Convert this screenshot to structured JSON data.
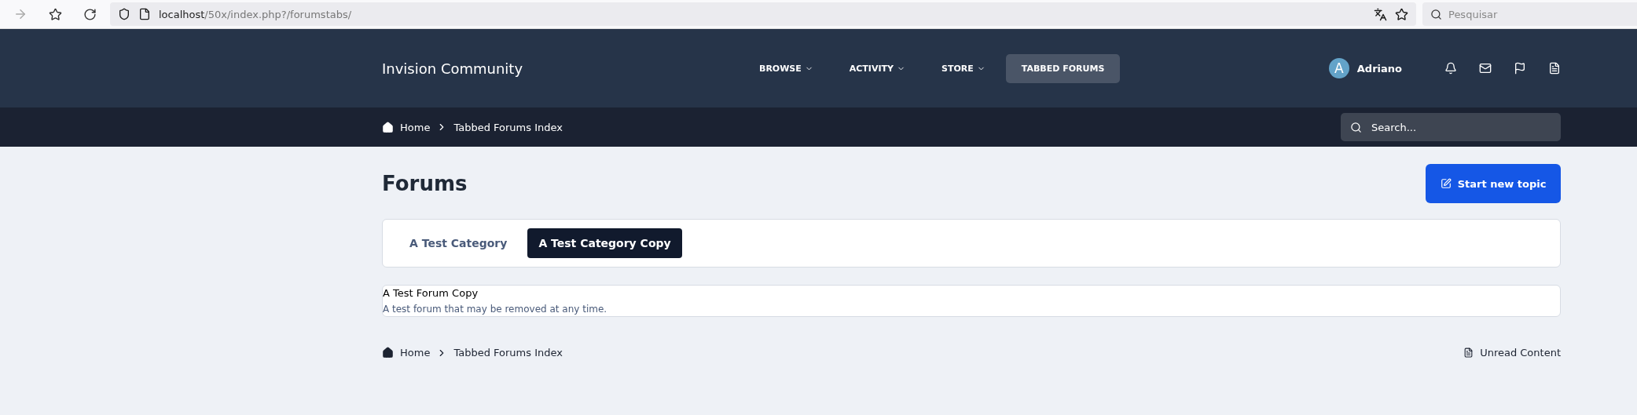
{
  "browser": {
    "url_host": "localhost",
    "url_path": "/50x/index.php?/forumstabs/",
    "search_placeholder": "Pesquisar"
  },
  "header": {
    "logo": "Invision Community",
    "nav": [
      {
        "label": "BROWSE",
        "dropdown": true,
        "selected": false
      },
      {
        "label": "ACTIVITY",
        "dropdown": true,
        "selected": false
      },
      {
        "label": "STORE",
        "dropdown": true,
        "selected": false
      },
      {
        "label": "TABBED FORUMS",
        "dropdown": false,
        "selected": true
      }
    ],
    "user": {
      "initial": "A",
      "name": "Adriano"
    }
  },
  "breadcrumb": [
    "Home",
    "Tabbed Forums Index"
  ],
  "search": {
    "placeholder": "Search..."
  },
  "page": {
    "title": "Forums",
    "action": "Start new topic"
  },
  "tabs": [
    {
      "label": "A Test Category",
      "selected": false
    },
    {
      "label": "A Test Category Copy",
      "selected": true
    }
  ],
  "forums": [
    {
      "name": "A Test Forum Copy",
      "description": "A test forum that may be removed at any time."
    }
  ],
  "footer": {
    "breadcrumb": [
      "Home",
      "Tabbed Forums Index"
    ],
    "link": "Unread Content"
  }
}
